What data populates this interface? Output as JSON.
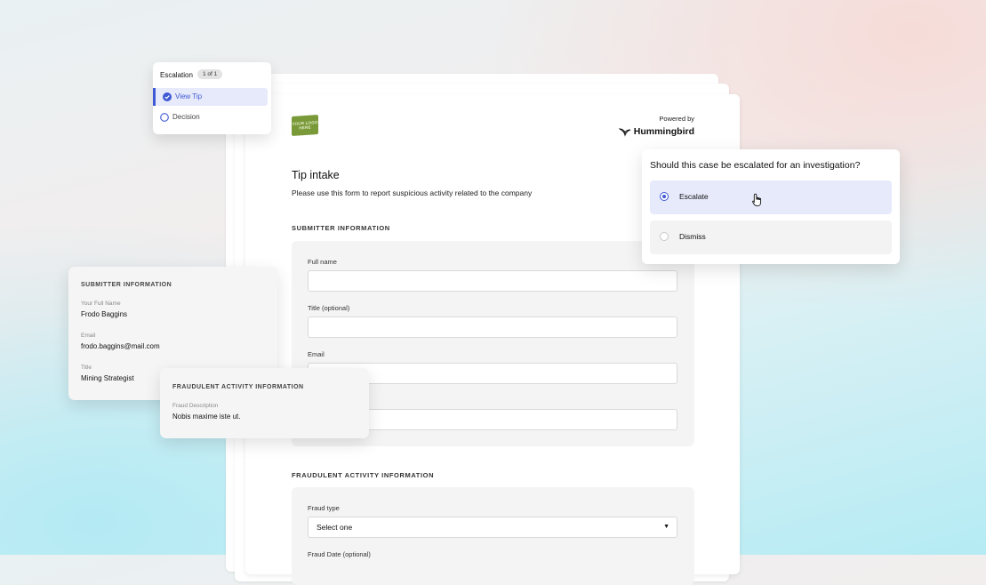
{
  "form": {
    "logo_text": "YOUR LOGO HERE",
    "powered_by": "Powered by",
    "brand": "Hummingbird",
    "title": "Tip intake",
    "subtitle": "Please use this form to report suspicious activity related to the company",
    "submitter_section": "SUBMITTER INFORMATION",
    "fields": {
      "full_name": "Full name",
      "title_optional": "Title (optional)",
      "email": "Email"
    },
    "fraud_section": "FRAUDULENT ACTIVITY INFORMATION",
    "fraud_type_label": "Fraud type",
    "fraud_type_value": "Select one",
    "fraud_date_label": "Fraud Date (optional)"
  },
  "escalation": {
    "title": "Escalation",
    "badge": "1 of 1",
    "steps": [
      {
        "label": "View Tip",
        "state": "complete"
      },
      {
        "label": "Decision",
        "state": "pending"
      }
    ]
  },
  "submitter_card": {
    "heading": "SUBMITTER INFORMATION",
    "full_name_label": "Your Full Name",
    "full_name_value": "Frodo Baggins",
    "email_label": "Email",
    "email_value": "frodo.baggins@mail.com",
    "title_label": "Title",
    "title_value": "Mining Strategist"
  },
  "fraud_card": {
    "heading": "FRAUDULENT ACTIVITY INFORMATION",
    "desc_label": "Fraud Description",
    "desc_value": "Nobis maxime iste ut."
  },
  "decision": {
    "question": "Should this case be escalated for an investigation?",
    "options": [
      {
        "label": "Escalate",
        "selected": true
      },
      {
        "label": "Dismiss",
        "selected": false
      }
    ]
  },
  "colors": {
    "accent": "#3f5ad4",
    "logo_green": "#7a9a3a"
  }
}
